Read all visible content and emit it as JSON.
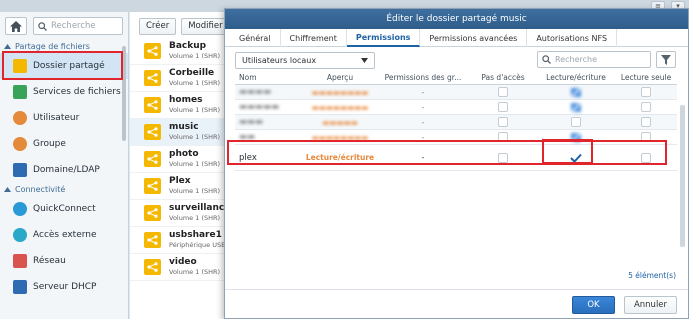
{
  "sidebar": {
    "search_placeholder": "Recherche",
    "section_file_sharing": "Partage de fichiers",
    "section_connectivity": "Connectivité",
    "items": [
      {
        "label": "Dossier partagé",
        "icon": "shared-folder-icon",
        "color": "#f5b800"
      },
      {
        "label": "Services de fichiers",
        "icon": "file-services-icon",
        "color": "#3aa35a"
      },
      {
        "label": "Utilisateur",
        "icon": "user-icon",
        "color": "#e58a3b"
      },
      {
        "label": "Groupe",
        "icon": "group-icon",
        "color": "#e58a3b"
      },
      {
        "label": "Domaine/LDAP",
        "icon": "domain-ldap-icon",
        "color": "#2f6bb3"
      },
      {
        "label": "QuickConnect",
        "icon": "quickconnect-icon",
        "color": "#2a9ad6"
      },
      {
        "label": "Accès externe",
        "icon": "external-access-icon",
        "color": "#2aa8c8"
      },
      {
        "label": "Réseau",
        "icon": "network-icon",
        "color": "#d9534f"
      },
      {
        "label": "Serveur DHCP",
        "icon": "dhcp-server-icon",
        "color": "#2f6bb3"
      }
    ]
  },
  "middle": {
    "create_label": "Créer",
    "modify_label": "Modifier",
    "shares": [
      {
        "name": "Backup",
        "sub": "Volume 1 (SHR)"
      },
      {
        "name": "Corbeille",
        "sub": "Volume 1 (SHR)"
      },
      {
        "name": "homes",
        "sub": "Volume 1 (SHR)"
      },
      {
        "name": "music",
        "sub": "Volume 1 (SHR)"
      },
      {
        "name": "photo",
        "sub": "Volume 1 (SHR)"
      },
      {
        "name": "Plex",
        "sub": "Volume 1 (SHR)"
      },
      {
        "name": "surveillance",
        "sub": "Volume 1 (SHR)"
      },
      {
        "name": "usbshare1",
        "sub": "Périphérique USB"
      },
      {
        "name": "video",
        "sub": "Volume 1 (SHR)"
      }
    ]
  },
  "dialog": {
    "title": "Éditer le dossier partagé music",
    "tabs": [
      "Général",
      "Chiffrement",
      "Permissions",
      "Permissions avancées",
      "Autorisations NFS"
    ],
    "user_select": "Utilisateurs locaux",
    "search_placeholder": "Recherche",
    "columns": [
      "Nom",
      "Aperçu",
      "Permissions des gr...",
      "Pas d'accès",
      "Lecture/écriture",
      "Lecture seule"
    ],
    "plex_row": {
      "name": "plex",
      "preview": "Lecture/écriture",
      "group_perm": "-"
    },
    "dash": "-",
    "count": "5 élément(s)",
    "ok_label": "OK",
    "cancel_label": "Annuler"
  },
  "colors": {
    "accent": "#1e62a5",
    "title_bar": "#2f5d8c",
    "highlight": "#e0262c",
    "preview_orange": "#e8883b"
  }
}
